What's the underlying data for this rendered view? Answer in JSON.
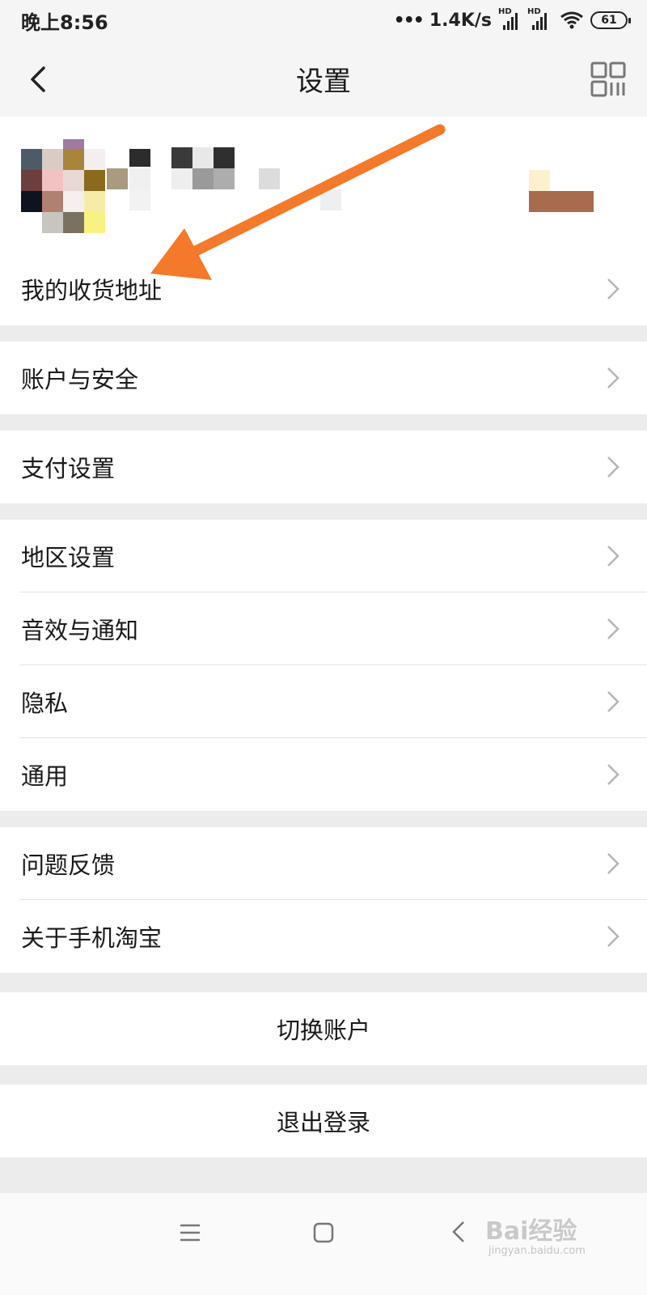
{
  "status_bar": {
    "time": "晚上8:56",
    "network_speed": "1.4K/s",
    "hd_label": "HD",
    "battery": "61"
  },
  "nav": {
    "title": "设置"
  },
  "menu": {
    "group1": [
      {
        "label": "我的收货地址"
      }
    ],
    "group2": [
      {
        "label": "账户与安全"
      }
    ],
    "group3": [
      {
        "label": "支付设置"
      }
    ],
    "group4": [
      {
        "label": "地区设置"
      },
      {
        "label": "音效与通知"
      },
      {
        "label": "隐私"
      },
      {
        "label": "通用"
      }
    ],
    "group5": [
      {
        "label": "问题反馈"
      },
      {
        "label": "关于手机淘宝"
      }
    ]
  },
  "actions": {
    "switch_account": "切换账户",
    "logout": "退出登录"
  },
  "watermark": {
    "brand": "Bai经验",
    "url": "jingyan.baidu.com"
  },
  "colors": {
    "annotation_arrow": "#f5792a",
    "chevron": "#b5b5b5",
    "group_gap": "#ececec"
  }
}
